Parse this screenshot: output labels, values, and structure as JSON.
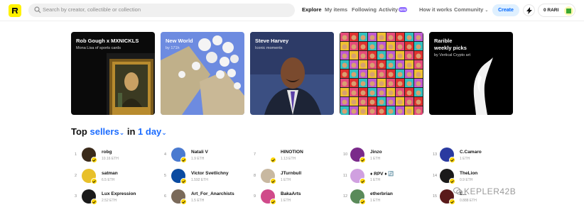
{
  "header": {
    "search_placeholder": "Search by creator, collectible or collection",
    "nav": {
      "explore": "Explore",
      "my_items": "My items",
      "following": "Following",
      "activity": "Activity",
      "activity_badge": "NEW",
      "how_it_works": "How it works",
      "community": "Community"
    },
    "create": "Create",
    "balance": "0 RARI"
  },
  "cards": [
    {
      "title": "Rob Gough x MXNICKLS",
      "subtitle": "Mona Lisa of sports cards"
    },
    {
      "title": "New World",
      "subtitle": "by 171h"
    },
    {
      "title": "Steve Harvey",
      "subtitle": "Iconic moments"
    },
    {
      "title": "",
      "subtitle": ""
    },
    {
      "title": "Rarible\nweekly picks",
      "subtitle": "by Vertical Crypto art"
    }
  ],
  "top": {
    "prefix": "Top",
    "mode": "sellers",
    "in": "in",
    "period": "1 day"
  },
  "sellers": [
    {
      "rank": "1",
      "name": "robg",
      "amount": "10.16 ETH"
    },
    {
      "rank": "2",
      "name": "satman",
      "amount": "6.5 ETH"
    },
    {
      "rank": "3",
      "name": "Lux Expression",
      "amount": "2.52 ETH"
    },
    {
      "rank": "4",
      "name": "Natali V",
      "amount": "1.9 ETH"
    },
    {
      "rank": "5",
      "name": "Victor Svetlichny",
      "amount": "1.592 ETH"
    },
    {
      "rank": "6",
      "name": "Art_For_Anarchists",
      "amount": "1.5 ETH"
    },
    {
      "rank": "7",
      "name": "HINOTION",
      "amount": "1.13 ETH"
    },
    {
      "rank": "8",
      "name": "JTurnbull",
      "amount": "1 ETH"
    },
    {
      "rank": "9",
      "name": "BakaArts",
      "amount": "1 ETH"
    },
    {
      "rank": "10",
      "name": "Jinzo",
      "amount": "1 ETH"
    },
    {
      "rank": "11",
      "name": "♦ RPV ♦ 🔄",
      "amount": "1 ETH"
    },
    {
      "rank": "12",
      "name": "etherbrian",
      "amount": "1 ETH"
    },
    {
      "rank": "13",
      "name": "C.Camaro",
      "amount": "1 ETH"
    },
    {
      "rank": "14",
      "name": "TheLion",
      "amount": "0.9 ETH"
    },
    {
      "rank": "15",
      "name": "E...",
      "amount": "0.888 ETH"
    }
  ],
  "watermark": "KEPLER42B",
  "colors": {
    "accent": "#1a6bff",
    "logo": "#fff200",
    "verified": "#ffd500",
    "activity_badge": "#8f6bff"
  }
}
